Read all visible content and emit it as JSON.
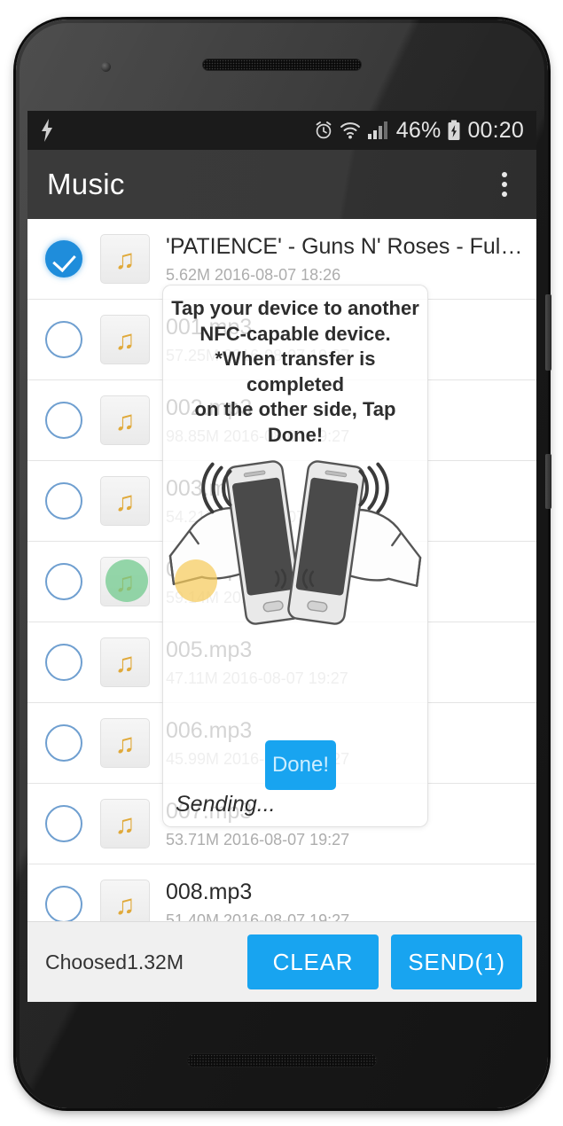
{
  "status_bar": {
    "charging_icon": "lightning-bolt-icon",
    "alarm_icon": "alarm-clock-icon",
    "wifi_icon": "wifi-icon",
    "signal_icon": "cellular-signal-icon",
    "battery_icon": "battery-charging-icon",
    "battery_percent": "46%",
    "clock": "00:20"
  },
  "action_bar": {
    "title": "Music",
    "overflow_icon": "overflow-menu-icon"
  },
  "file_list": [
    {
      "name": "'PATIENCE' - Guns N' Roses - Full Instrum...",
      "size": "5.62M",
      "date": "2016-08-07 18:26",
      "checked": true
    },
    {
      "name": "001.mp3",
      "size": "57.25M",
      "date": "2016-08-07 19:27",
      "checked": false
    },
    {
      "name": "002.mp3",
      "size": "98.85M",
      "date": "2016-08-07 19:27",
      "checked": false
    },
    {
      "name": "003.mp3",
      "size": "54.21M",
      "date": "2016-08-07 19:27",
      "checked": false
    },
    {
      "name": "004.mp3",
      "size": "59.14M",
      "date": "2016-08-07 19:27",
      "checked": false
    },
    {
      "name": "005.mp3",
      "size": "47.11M",
      "date": "2016-08-07 19:27",
      "checked": false
    },
    {
      "name": "006.mp3",
      "size": "45.99M",
      "date": "2016-08-07 19:27",
      "checked": false
    },
    {
      "name": "007.mp3",
      "size": "53.71M",
      "date": "2016-08-07 19:27",
      "checked": false
    },
    {
      "name": "008.mp3",
      "size": "51.40M",
      "date": "2016-08-07 19:27",
      "checked": false
    }
  ],
  "bottom_bar": {
    "chosen_label": "Choosed1.32M",
    "clear_label": "CLEAR",
    "send_label": "SEND(1)"
  },
  "nfc_dialog": {
    "line1": "Tap your device to another",
    "line2": "NFC-capable device.",
    "line3": "*When transfer is completed",
    "line4": "on the other side, Tap Done!",
    "illustration_icon": "two-phones-nfc-tap-illustration",
    "sending_label": "Sending...",
    "done_label": "Done!",
    "dot_green": "#6DC98A",
    "dot_yellow": "#F5CB5C"
  },
  "theme": {
    "accent": "#18a4f0",
    "checkbox_checked": "#1f8ddb",
    "music_icon_color": "#e0a93a",
    "action_bar_bg": "#3a3a3a",
    "status_bar_bg": "#1b1b1b"
  },
  "device": {
    "earpiece_icon": "earpiece-speaker-grille",
    "camera_icon": "front-camera-icon",
    "bottom_speaker_icon": "bottom-speaker-grille",
    "power_button": "power-button",
    "volume_button": "volume-button"
  }
}
